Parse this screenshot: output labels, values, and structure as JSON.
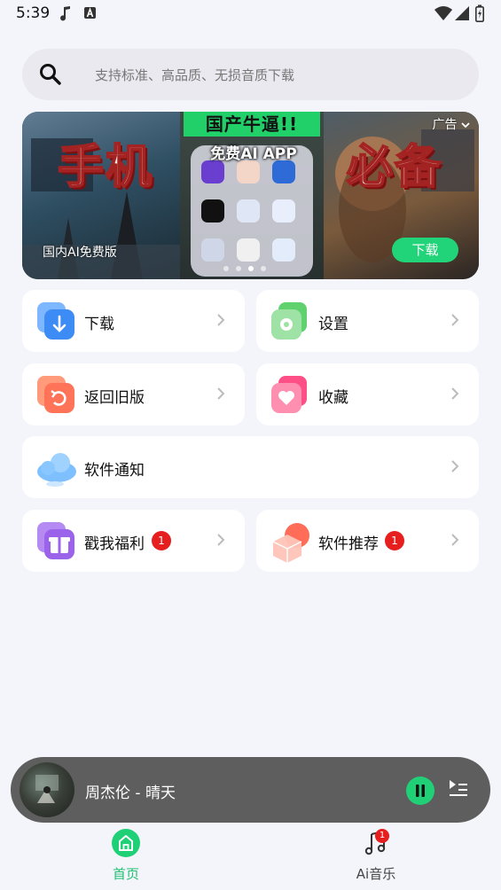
{
  "status_bar": {
    "time": "5:39"
  },
  "search": {
    "placeholder": "支持标准、高品质、无损音质下载"
  },
  "banner": {
    "ad_label": "广告",
    "sticker": "国产牛逼!!",
    "headline": "免费AI APP",
    "left_big": "手机",
    "right_big": "必备",
    "caption": "国内AI免费版",
    "download_label": "下载",
    "dot_count": 4,
    "active_dot": 3
  },
  "menu": {
    "download": "下载",
    "settings": "设置",
    "old_version": "返回旧版",
    "favorites": "收藏",
    "notice": "软件通知",
    "welfare": "戳我福利",
    "welfare_badge": "1",
    "recommend": "软件推荐",
    "recommend_badge": "1"
  },
  "player": {
    "title": "周杰伦 - 晴天"
  },
  "nav": {
    "home": "首页",
    "ai_music": "Ai音乐",
    "ai_music_badge": "1"
  },
  "colors": {
    "accent": "#20d077",
    "badge": "#e61e1e"
  }
}
